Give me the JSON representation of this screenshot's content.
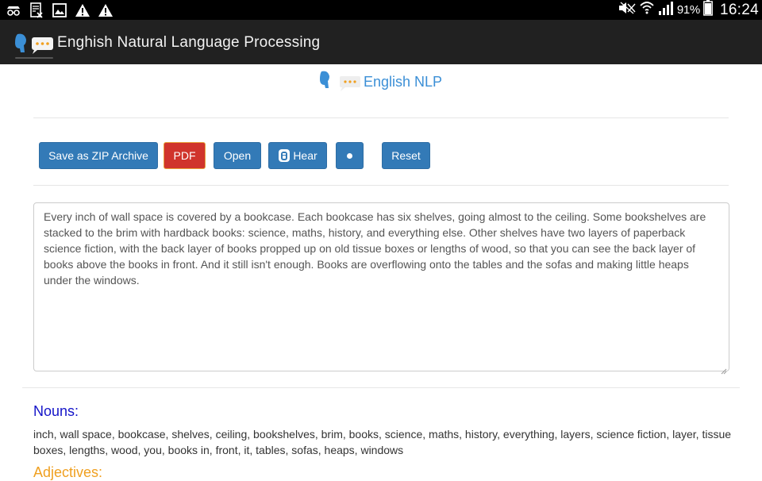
{
  "status_bar": {
    "icons": [
      "incognito-icon",
      "document-x-icon",
      "image-icon",
      "warning-icon",
      "warning-icon"
    ],
    "battery_percent": "91%",
    "time": "16:24"
  },
  "action_bar": {
    "title": "Enghish Natural Language Processing"
  },
  "brand": {
    "label": "English NLP",
    "accent_color": "#3b8fd6"
  },
  "toolbar": {
    "save_zip": "Save as ZIP Archive",
    "pdf": "PDF",
    "open": "Open",
    "hear": "Hear",
    "reset": "Reset"
  },
  "editor": {
    "text": "Every inch of wall space is covered by a bookcase. Each bookcase has six shelves, going almost to the ceiling. Some bookshelves are stacked to the brim with hardback books: science, maths, history, and everything else. Other shelves have two layers of paperback science fiction, with the back layer of books propped up on old tissue boxes or lengths of wood, so that you can see the back layer of books above the books in front. And it still isn't enough. Books are overflowing onto the tables and the sofas and making little heaps under the windows."
  },
  "results": {
    "nouns_title": "Nouns:",
    "nouns": "inch, wall space, bookcase, shelves, ceiling, bookshelves, brim, books, science, maths, history, everything, layers, science fiction, layer, tissue boxes, lengths, wood, you, books in, front, it, tables, sofas, heaps, windows",
    "adjectives_title": "Adjectives:"
  },
  "colors": {
    "primary_button": "#337ab7",
    "pdf_button": "#d0342c",
    "nouns_title": "#1414c8",
    "adjectives_title": "#f0a020"
  }
}
